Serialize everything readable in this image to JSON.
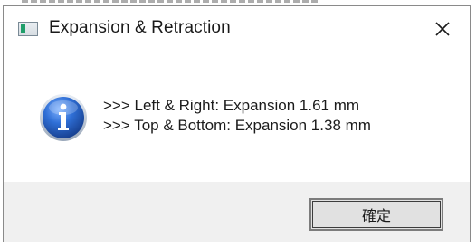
{
  "window": {
    "title": "Expansion & Retraction",
    "close_glyph": "✕",
    "icon": "app-window-icon"
  },
  "message": {
    "icon": "info-icon",
    "lines": [
      ">>> Left & Right: Expansion 1.61 mm",
      ">>> Top & Bottom: Expansion 1.38 mm"
    ]
  },
  "buttons": {
    "ok_label": "確定"
  },
  "colors": {
    "info_blue": "#1f5fc2",
    "footer_bg": "#f0f0f0",
    "button_bg": "#e1e1e1"
  }
}
